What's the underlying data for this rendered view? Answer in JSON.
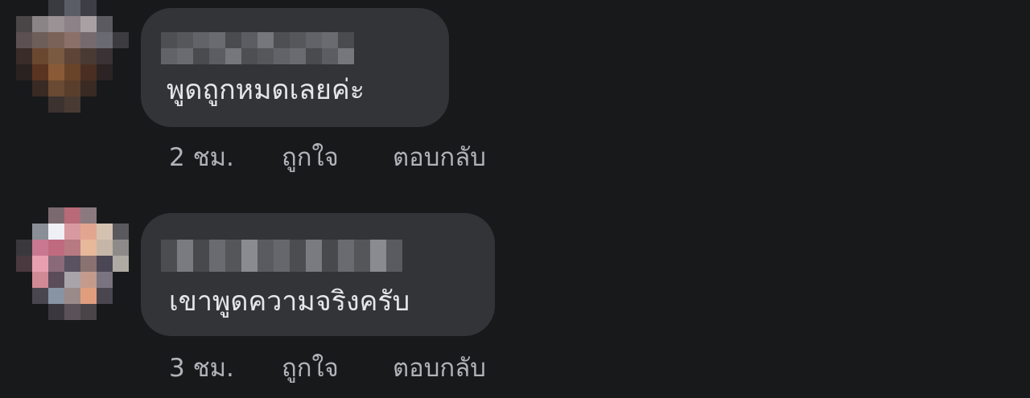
{
  "comments": [
    {
      "text": "พูดถูกหมดเลยค่ะ",
      "time": "2 ชม.",
      "like_label": "ถูกใจ",
      "reply_label": "ตอบกลับ"
    },
    {
      "text": "เขาพูดความจริงครับ",
      "time": "3 ชม.",
      "like_label": "ถูกใจ",
      "reply_label": "ตอบกลับ"
    }
  ],
  "colors": {
    "background": "#18191b",
    "bubble": "#333437",
    "text": "#e4e6eb",
    "secondary_text": "#b0b3b8"
  }
}
